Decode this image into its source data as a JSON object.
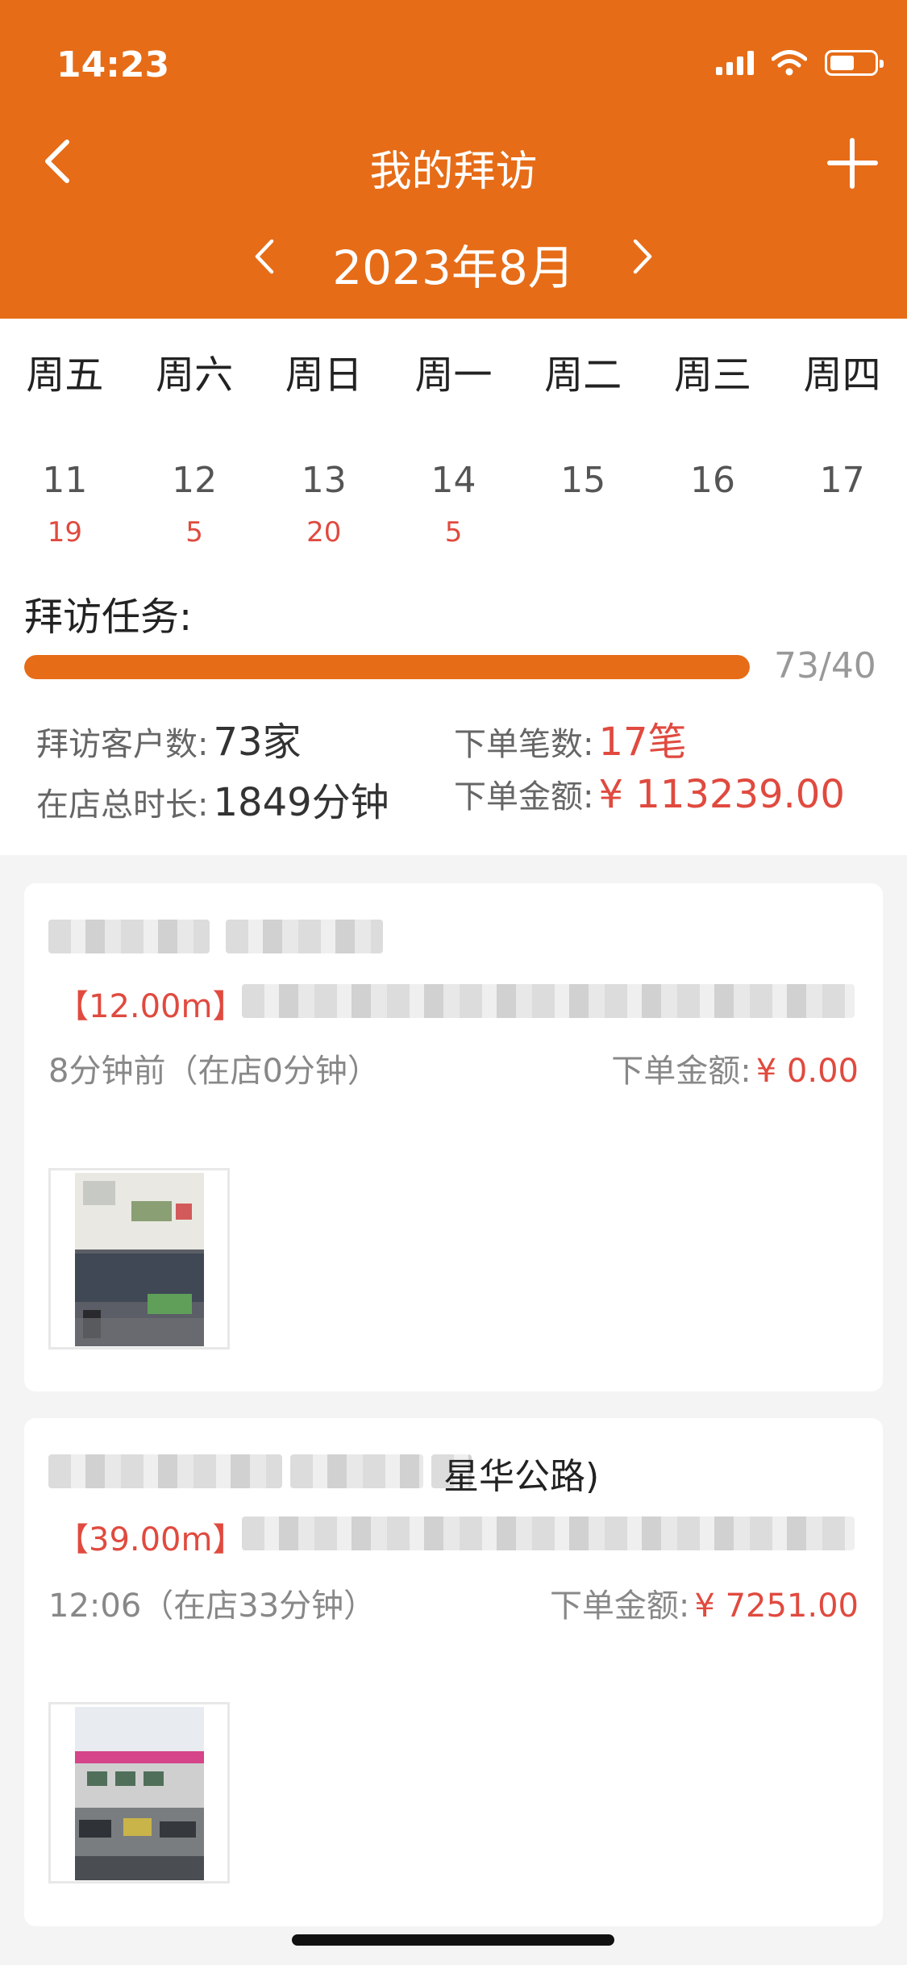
{
  "status_bar": {
    "time": "14:23"
  },
  "nav": {
    "title": "我的拜访",
    "back_icon": "chevron-left-icon",
    "add_icon": "plus-icon"
  },
  "month": {
    "label": "2023年8月"
  },
  "calendar": {
    "weekdays": [
      "周五",
      "周六",
      "周日",
      "周一",
      "周二",
      "周三",
      "周四"
    ],
    "dates": [
      {
        "day": "11",
        "count": "19"
      },
      {
        "day": "12",
        "count": "5"
      },
      {
        "day": "13",
        "count": "20"
      },
      {
        "day": "14",
        "count": "5"
      },
      {
        "day": "15",
        "count": ""
      },
      {
        "day": "16",
        "count": ""
      },
      {
        "day": "17",
        "count": ""
      }
    ]
  },
  "task": {
    "label": "拜访任务:",
    "progress_text": "73/40",
    "progress_fraction": 1.0,
    "stats": {
      "customers_label": "拜访客户数:",
      "customers_value": "73家",
      "orders_label": "下单笔数:",
      "orders_value": "17笔",
      "duration_label": "在店总时长:",
      "duration_value": "1849分钟",
      "amount_label": "下单金额:",
      "amount_value": "¥ 113239.00"
    }
  },
  "visits": [
    {
      "name_suffix": "",
      "distance": "【12.00m】",
      "time_info": "8分钟前（在店0分钟）",
      "order_label": "下单金额:",
      "order_amount": "¥ 0.00"
    },
    {
      "name_suffix": "星华公路)",
      "distance": "【39.00m】",
      "time_info": "12:06（在店33分钟）",
      "order_label": "下单金额:",
      "order_amount": "¥ 7251.00"
    }
  ],
  "colors": {
    "accent": "#e66c17",
    "danger": "#e04a3f"
  }
}
